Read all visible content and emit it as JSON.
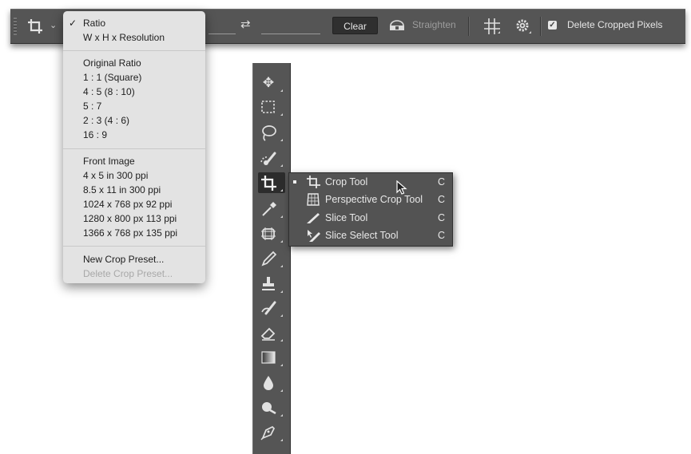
{
  "options_bar": {
    "tool_icon": "crop-icon",
    "clear_label": "Clear",
    "straighten_label": "Straighten",
    "delete_cropped_label": "Delete Cropped Pixels",
    "delete_cropped_checked": true
  },
  "ratio_menu": {
    "selected": "Ratio",
    "groups": [
      {
        "items": [
          {
            "label": "Ratio",
            "checked": true
          },
          {
            "label": "W x H x Resolution"
          }
        ]
      },
      {
        "items": [
          {
            "label": "Original Ratio"
          },
          {
            "label": "1 : 1 (Square)"
          },
          {
            "label": "4 : 5 (8 : 10)"
          },
          {
            "label": "5 : 7"
          },
          {
            "label": "2 : 3 (4 : 6)"
          },
          {
            "label": "16 : 9"
          }
        ]
      },
      {
        "items": [
          {
            "label": "Front Image"
          },
          {
            "label": "4 x 5 in 300 ppi"
          },
          {
            "label": "8.5 x 11 in 300 ppi"
          },
          {
            "label": "1024 x 768 px 92 ppi"
          },
          {
            "label": "1280 x 800 px 113 ppi"
          },
          {
            "label": "1366 x 768 px 135 ppi"
          }
        ]
      },
      {
        "items": [
          {
            "label": "New Crop Preset..."
          },
          {
            "label": "Delete Crop Preset...",
            "disabled": true
          }
        ]
      }
    ]
  },
  "toolbar": {
    "tools": [
      {
        "name": "move-tool",
        "icon": "move-icon"
      },
      {
        "name": "marquee-tool",
        "icon": "marquee-icon"
      },
      {
        "name": "lasso-tool",
        "icon": "lasso-icon"
      },
      {
        "name": "quick-selection-tool",
        "icon": "quick-selection-icon"
      },
      {
        "name": "crop-tool",
        "icon": "crop-icon",
        "active": true
      },
      {
        "name": "eyedropper-tool",
        "icon": "eyedropper-icon"
      },
      {
        "name": "spot-healing-tool",
        "icon": "healing-icon"
      },
      {
        "name": "brush-tool",
        "icon": "brush-icon"
      },
      {
        "name": "clone-stamp-tool",
        "icon": "stamp-icon"
      },
      {
        "name": "history-brush-tool",
        "icon": "history-brush-icon"
      },
      {
        "name": "eraser-tool",
        "icon": "eraser-icon"
      },
      {
        "name": "gradient-tool",
        "icon": "gradient-icon"
      },
      {
        "name": "blur-tool",
        "icon": "blur-icon"
      },
      {
        "name": "dodge-tool",
        "icon": "dodge-icon"
      },
      {
        "name": "pen-tool",
        "icon": "pen-icon"
      }
    ]
  },
  "flyout": {
    "items": [
      {
        "label": "Crop Tool",
        "shortcut": "C",
        "icon": "crop-icon",
        "selected": true
      },
      {
        "label": "Perspective Crop Tool",
        "shortcut": "C",
        "icon": "perspective-crop-icon"
      },
      {
        "label": "Slice Tool",
        "shortcut": "C",
        "icon": "slice-icon"
      },
      {
        "label": "Slice Select Tool",
        "shortcut": "C",
        "icon": "slice-select-icon"
      }
    ]
  },
  "colors": {
    "panel_bg": "#555555",
    "menu_bg": "#e3e3e3",
    "flyout_bg": "#535353",
    "active_tool_bg": "#2c2c2c"
  }
}
